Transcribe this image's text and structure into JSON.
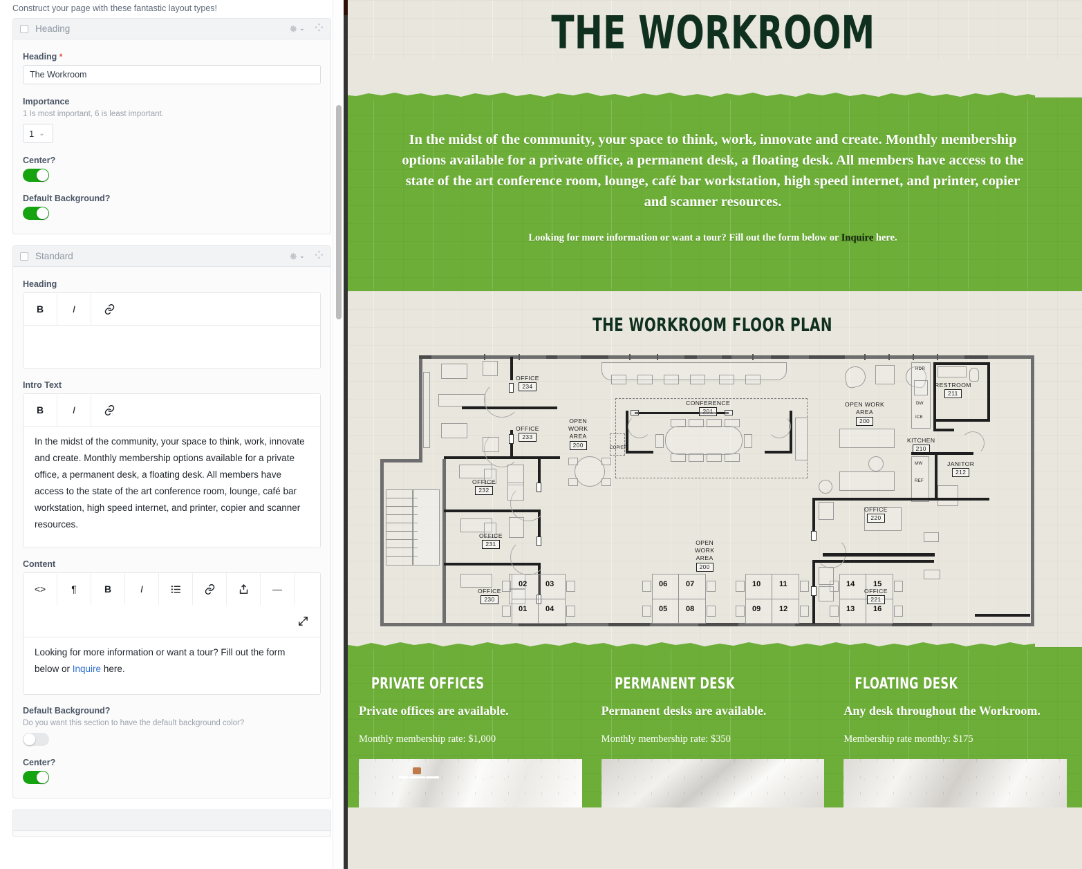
{
  "editor": {
    "construct_note": "Construct your page with these fantastic layout types!",
    "panels": [
      {
        "title": "Heading",
        "gear_icon": "gear-icon",
        "move_icon": "move-handle-icon",
        "fields": {
          "heading_label": "Heading",
          "heading_required": "*",
          "heading_value": "The Workroom",
          "importance_label": "Importance",
          "importance_hint": "1 Is most important, 6 is least important.",
          "importance_value": "1",
          "center_label": "Center?",
          "center_state": "on",
          "default_bg_label": "Default Background?",
          "default_bg_state": "on"
        }
      },
      {
        "title": "Standard",
        "gear_icon": "gear-icon",
        "move_icon": "move-handle-icon",
        "fields": {
          "heading_label": "Heading",
          "heading_value": "",
          "intro_label": "Intro Text",
          "intro_value": "In the midst of the community, your space to think, work, innovate and create. Monthly membership options available for a private office, a permanent desk, a floating desk. All members have access to the state of the art conference room, lounge, café bar workstation, high speed internet, and printer, copier and scanner resources.",
          "content_label": "Content",
          "content_prefix": "Looking for more information or want a tour? Fill out the form below or ",
          "content_link": "Inquire",
          "content_suffix": " here.",
          "default_bg_label": "Default Background?",
          "default_bg_hint": "Do you want this section to have the default background color?",
          "default_bg_state": "off",
          "center_label": "Center?",
          "center_state": "on"
        },
        "toolbar_small": [
          "B",
          "I",
          "link-icon"
        ],
        "toolbar_full": [
          "code-icon",
          "paragraph-icon",
          "B",
          "I",
          "bullet-list-icon",
          "link-icon",
          "upload-icon",
          "horizontal-rule-icon",
          "expand-icon"
        ]
      }
    ],
    "colors": {
      "toggle_on": "#15a310",
      "required_star": "#e2513b",
      "link": "#2f6fd0"
    }
  },
  "preview": {
    "hero_title": "The Workroom",
    "intro_paragraph": "In the midst of the community, your space to think, work, innovate and create. Monthly membership options available for a private office, a permanent desk, a floating desk. All members have access to the state of the art conference room, lounge, café bar workstation, high speed internet, and printer, copier and scanner resources.",
    "cta_prefix": "Looking for more information or want a tour? Fill out the form below or ",
    "cta_link": "Inquire",
    "cta_suffix": " here.",
    "plan_title": "The Workroom Floor Plan",
    "colors": {
      "green": "#6cae37",
      "brick": "#e8e6dd",
      "dark_green": "#10301f"
    },
    "floorplan": {
      "rooms": [
        {
          "name": "OFFICE",
          "number": "234"
        },
        {
          "name": "OFFICE",
          "number": "233"
        },
        {
          "name": "OFFICE",
          "number": "232"
        },
        {
          "name": "OFFICE",
          "number": "231"
        },
        {
          "name": "OFFICE",
          "number": "230"
        },
        {
          "name": "OPEN WORK AREA",
          "number": "200"
        },
        {
          "name": "CONFERENCE",
          "number": "201"
        },
        {
          "name": "OPEN WORK AREA",
          "number": "200"
        },
        {
          "name": "OPEN WORK AREA",
          "number": "200"
        },
        {
          "name": "RESTROOM",
          "number": "211"
        },
        {
          "name": "KITCHEN",
          "number": "210"
        },
        {
          "name": "JANITOR",
          "number": "212"
        },
        {
          "name": "OFFICE",
          "number": "220"
        },
        {
          "name": "OFFICE",
          "number": "221"
        }
      ],
      "desk_numbers": [
        "02",
        "03",
        "01",
        "04",
        "06",
        "07",
        "05",
        "08",
        "10",
        "11",
        "09",
        "12",
        "14",
        "15",
        "13",
        "16"
      ],
      "annotations": [
        "COPIER",
        "REF",
        "DW",
        "MW",
        "HDR",
        "ICE"
      ]
    },
    "cards": [
      {
        "title": "Private Offices",
        "subtitle": "Private offices are available.",
        "rate": "Monthly membership rate: $1,000",
        "image": "office-interior-photo"
      },
      {
        "title": "Permanent Desk",
        "subtitle": "Permanent desks are available.",
        "rate": "Monthly membership rate: $350",
        "image": "open-ceiling-workspace-photo"
      },
      {
        "title": "Floating Desk",
        "subtitle": "Any desk throughout the Workroom.",
        "rate": "Membership rate monthly: $175",
        "image": "loft-ceiling-photo"
      }
    ]
  }
}
